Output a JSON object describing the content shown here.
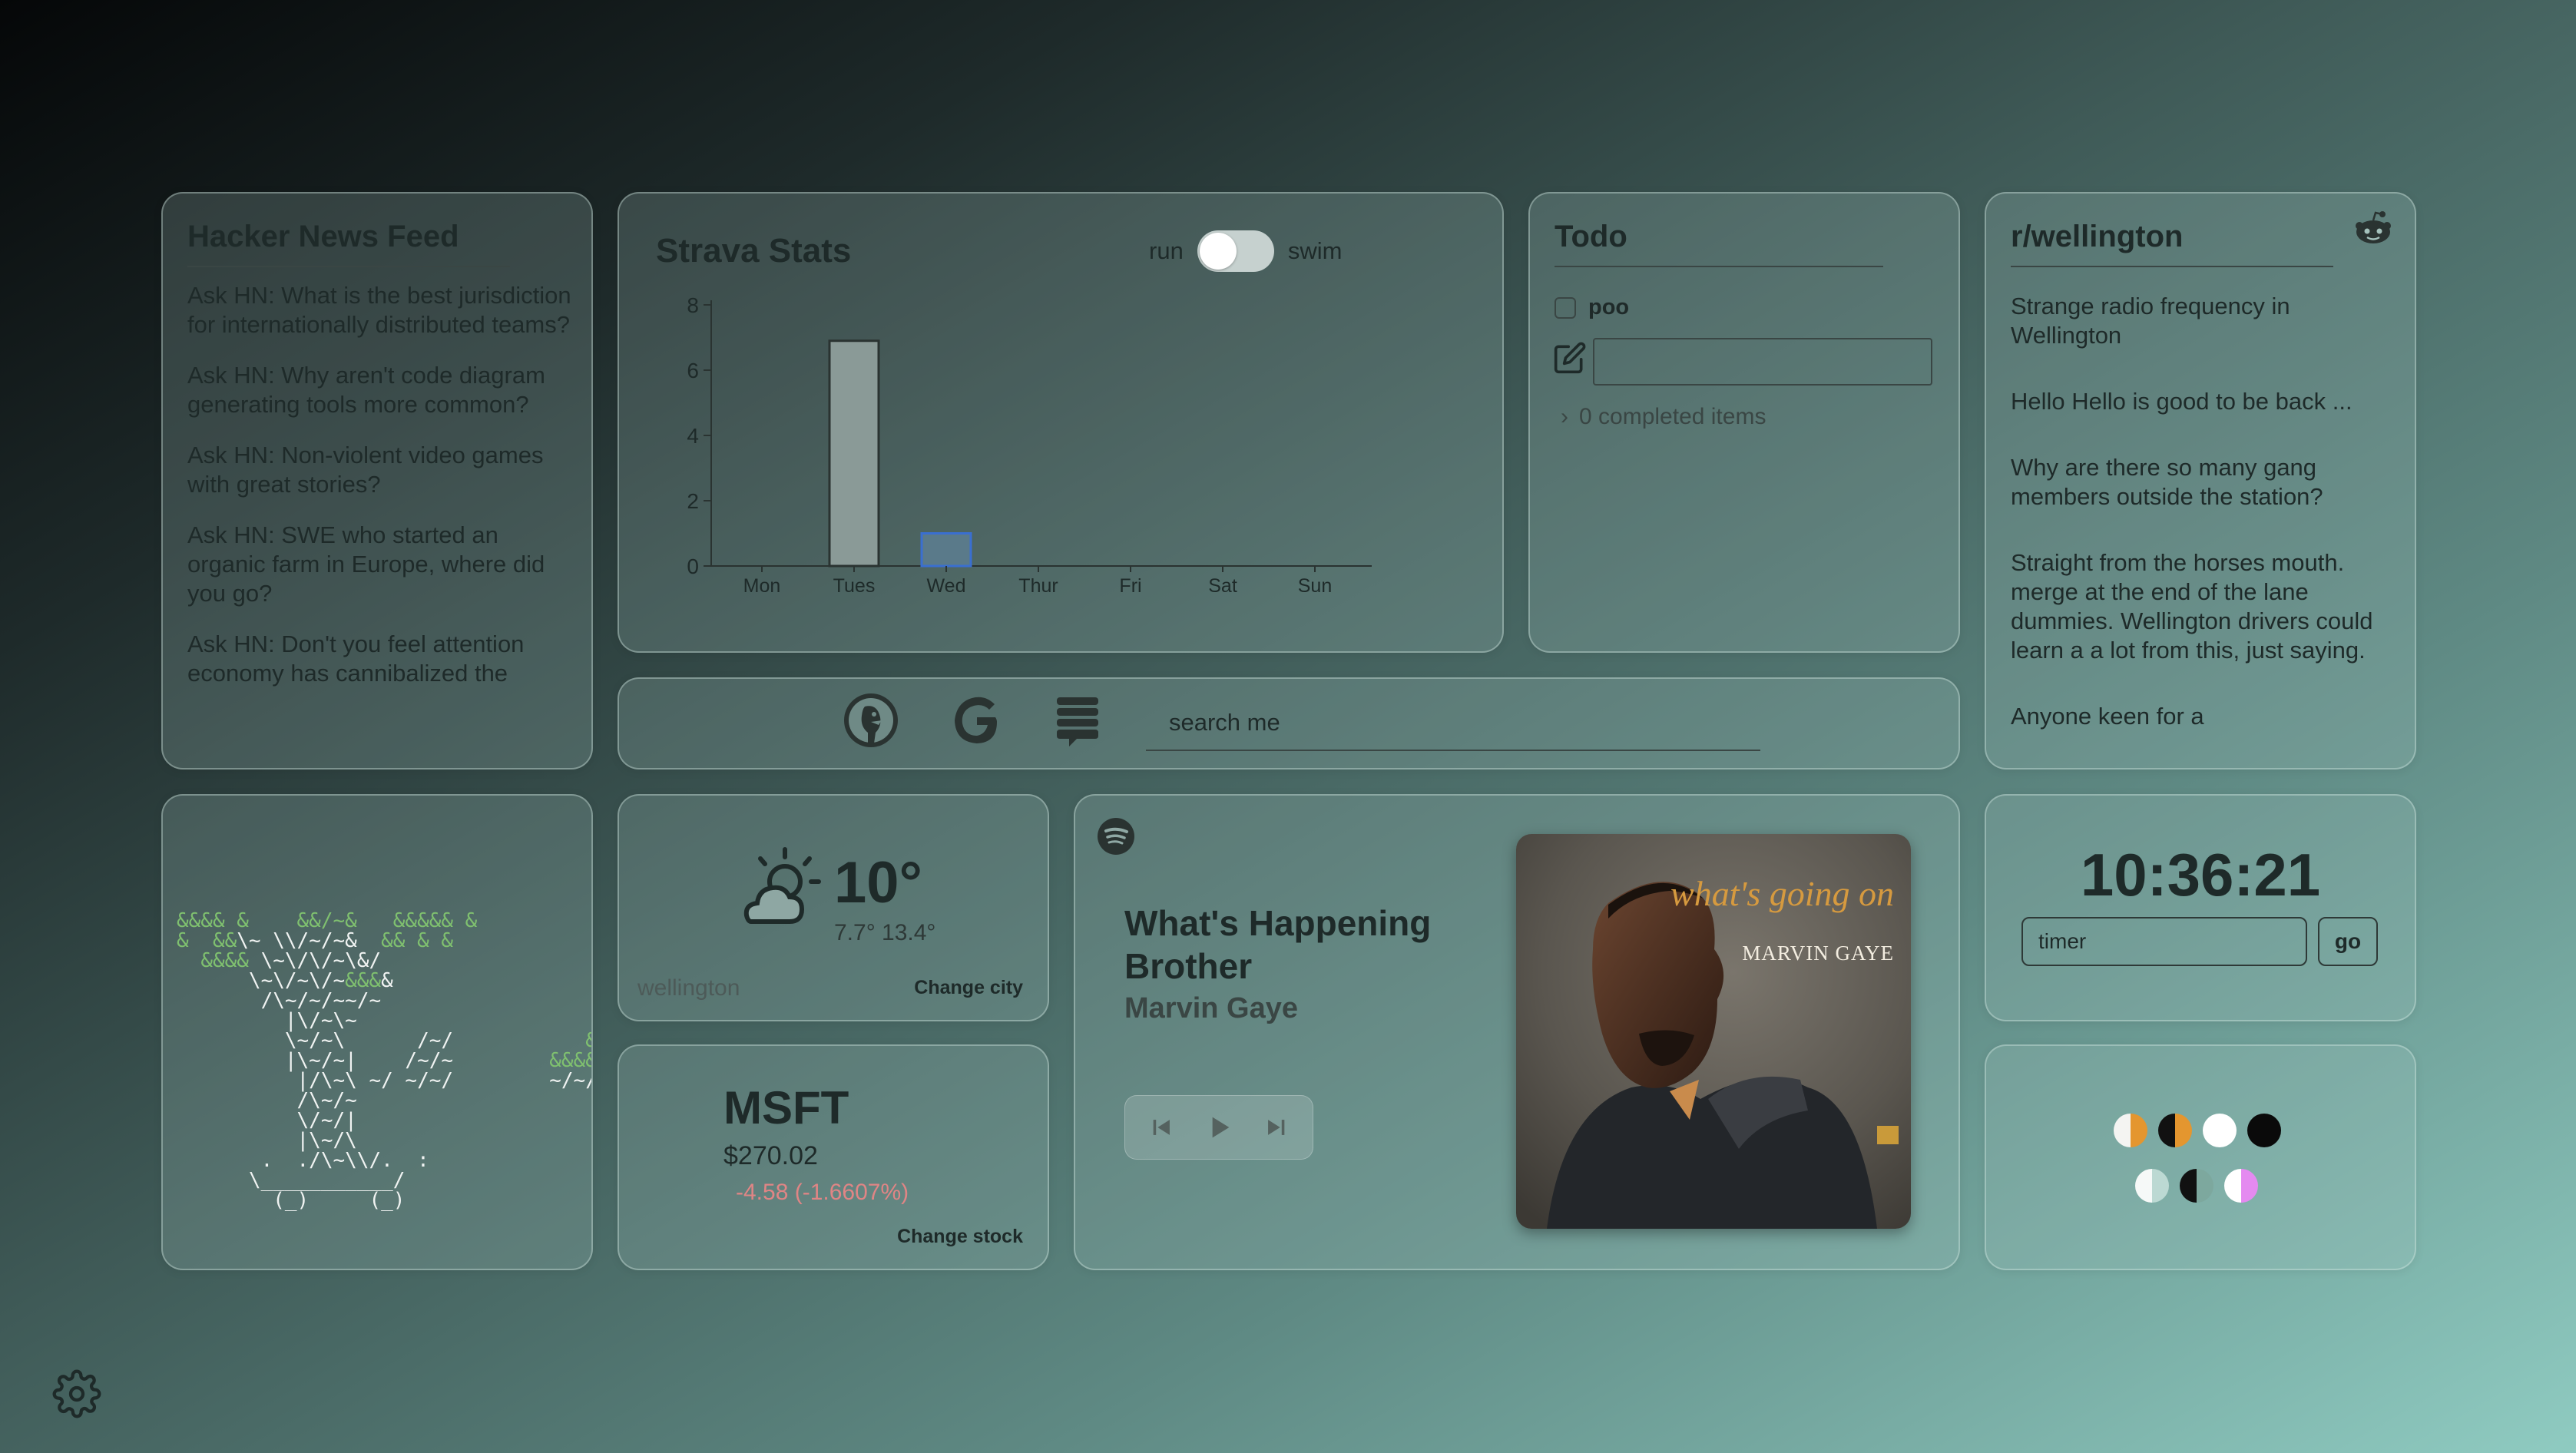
{
  "hacker_news": {
    "title": "Hacker News Feed",
    "items": [
      "Ask HN: What is the best jurisdiction for internationally distributed teams?",
      "Ask HN: Why aren't code diagram generating tools more common?",
      "Ask HN: Non-violent video games with great stories?",
      "Ask HN: SWE who started an organic farm in Europe, where did you go?",
      "Ask HN: Don't you feel attention economy has cannibalized the"
    ]
  },
  "strava": {
    "title": "Strava Stats",
    "toggle_left": "run",
    "toggle_right": "swim",
    "chart_data": {
      "type": "bar",
      "categories": [
        "Mon",
        "Tues",
        "Wed",
        "Thur",
        "Fri",
        "Sat",
        "Sun"
      ],
      "values": [
        0,
        6.9,
        1.0,
        0,
        0,
        0,
        0
      ],
      "ylim": [
        0,
        8
      ],
      "yticks": [
        0,
        2,
        4,
        6,
        8
      ],
      "title": "",
      "xlabel": "",
      "ylabel": "",
      "bar_colors": [
        "#8a9a97",
        "#8a9a97",
        "#5a7a8a",
        "#8a9a97",
        "#8a9a97",
        "#8a9a97",
        "#8a9a97"
      ],
      "bar_strokes": [
        "#2a3331",
        "#2a3331",
        "#3a6fd0",
        "#2a3331",
        "#2a3331",
        "#2a3331",
        "#2a3331"
      ]
    }
  },
  "todo": {
    "title": "Todo",
    "items": [
      {
        "label": "poo",
        "checked": false
      }
    ],
    "completed_text": "0 completed items"
  },
  "reddit": {
    "title": "r/wellington",
    "icon": "reddit-icon",
    "posts": [
      "Strange radio frequency in Wellington",
      "Hello Hello is good to be back ...",
      "Why are there so many gang members outside the station?",
      "Straight from the horses mouth. merge at the end of the lane dummies. Wellington drivers could learn a a lot from this, just saying.",
      "Anyone keen for a"
    ]
  },
  "search": {
    "placeholder": "search me",
    "engines": [
      "duckduckgo-icon",
      "google-icon",
      "stack-overflow-icon"
    ]
  },
  "weather": {
    "temp": "10°",
    "range": "7.7° 13.4°",
    "city": "wellington",
    "change_label": "Change city",
    "icon": "partly-cloudy-icon"
  },
  "stock": {
    "symbol": "MSFT",
    "price": "$270.02",
    "change": "-4.58 (-1.6607%)",
    "change_label": "Change stock",
    "change_color": "#e08585"
  },
  "spotify": {
    "title": "What's Happening Brother",
    "artist": "Marvin Gaye",
    "album_text_1": "what's going on",
    "album_text_2": "MARVIN GAYE"
  },
  "clock": {
    "time": "10:36:21",
    "timer_placeholder": "timer",
    "go_label": "go"
  },
  "themes": {
    "row1": [
      {
        "left": "#f4f4f2",
        "right": "#e4962f"
      },
      {
        "left": "#111111",
        "right": "#e4962f"
      },
      {
        "left": "#ffffff",
        "right": "#ffffff"
      },
      {
        "left": "#0a0a0a",
        "right": "#0a0a0a"
      }
    ],
    "row2": [
      {
        "left": "#f6f9f8",
        "right": "#bcd9d3"
      },
      {
        "left": "#111111",
        "right": "#7da89e"
      },
      {
        "left": "#ffffff",
        "right": "#e48af0"
      }
    ]
  },
  "colors": {
    "accent": "#1e2a29",
    "negative": "#e08585",
    "selected_bar_stroke": "#3a6fd0",
    "bonsai_leaf": "#7fc06f"
  }
}
